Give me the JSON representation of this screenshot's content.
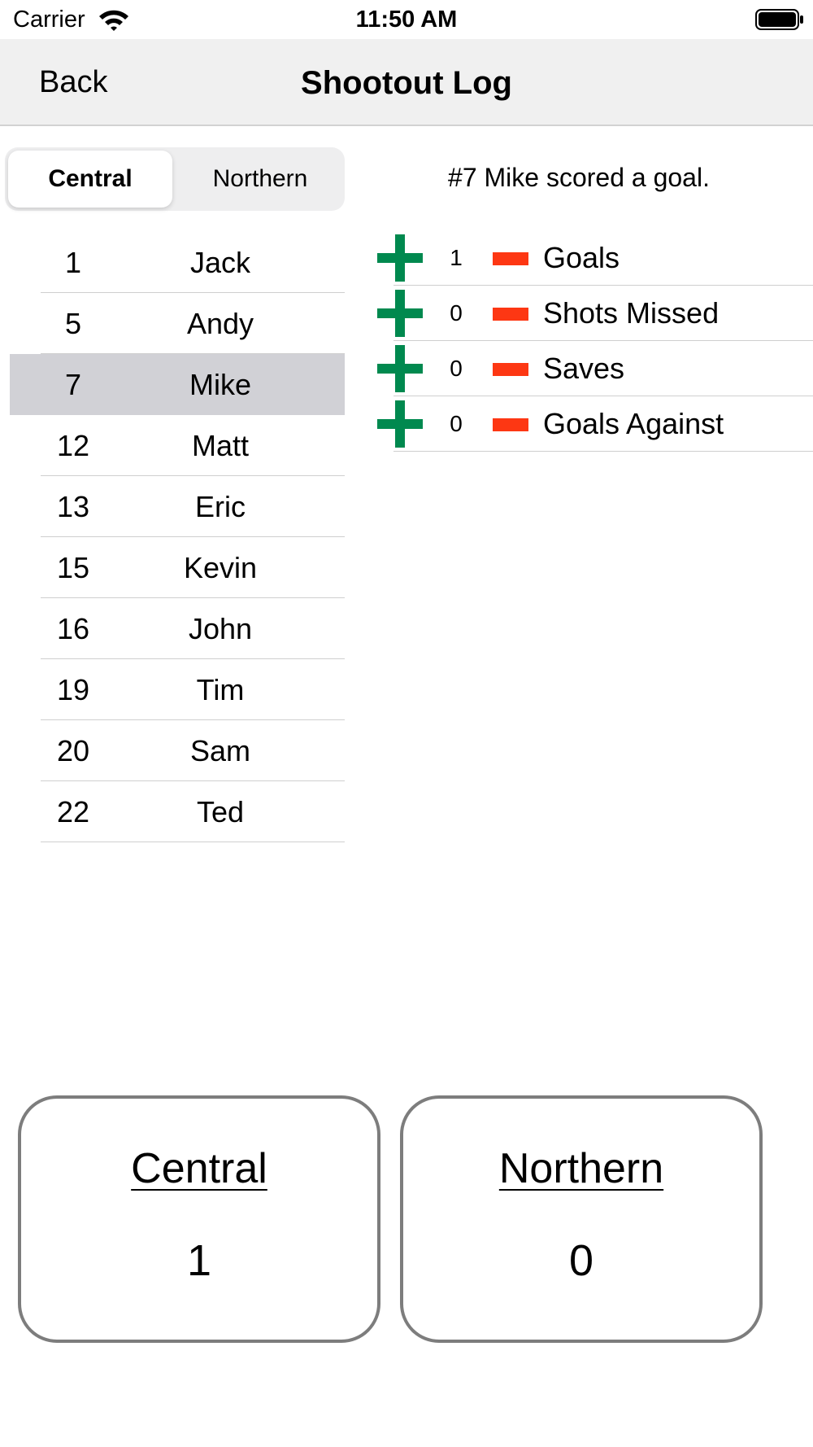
{
  "status_bar": {
    "carrier": "Carrier",
    "time": "11:50 AM",
    "wifi_icon": "wifi-icon",
    "battery_icon": "battery-icon"
  },
  "nav": {
    "back_label": "Back",
    "title": "Shootout Log"
  },
  "segmented": {
    "options": [
      "Central",
      "Northern"
    ],
    "selected": "Central"
  },
  "players": [
    {
      "number": "1",
      "name": "Jack"
    },
    {
      "number": "5",
      "name": "Andy"
    },
    {
      "number": "7",
      "name": "Mike"
    },
    {
      "number": "12",
      "name": "Matt"
    },
    {
      "number": "13",
      "name": "Eric"
    },
    {
      "number": "15",
      "name": "Kevin"
    },
    {
      "number": "16",
      "name": "John"
    },
    {
      "number": "19",
      "name": "Tim"
    },
    {
      "number": "20",
      "name": "Sam"
    },
    {
      "number": "22",
      "name": "Ted"
    }
  ],
  "selected_player_index": 2,
  "event_message": "#7 Mike scored a goal.",
  "stats": [
    {
      "count": "1",
      "label": "Goals"
    },
    {
      "count": "0",
      "label": "Shots Missed"
    },
    {
      "count": "0",
      "label": "Saves"
    },
    {
      "count": "0",
      "label": "Goals Against"
    }
  ],
  "stat_icons": {
    "increment": "plus-icon",
    "decrement": "minus-icon"
  },
  "colors": {
    "plus": "#00894f",
    "minus": "#fd3713",
    "selected_row": "#d1d1d6",
    "nav_background": "#f0f0f0"
  },
  "scores": [
    {
      "team": "Central",
      "score": "1"
    },
    {
      "team": "Northern",
      "score": "0"
    }
  ]
}
